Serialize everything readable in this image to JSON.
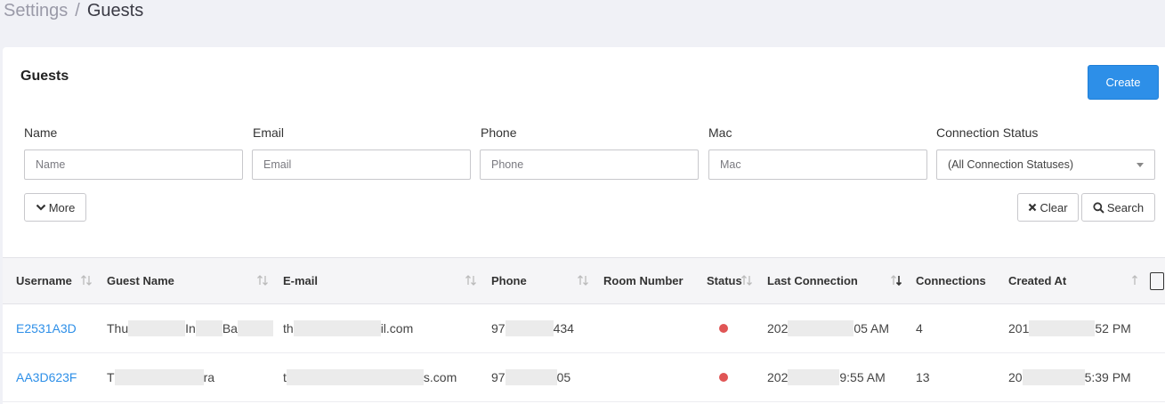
{
  "breadcrumb": {
    "parent": "Settings",
    "separator": "/",
    "current": "Guests"
  },
  "card": {
    "title": "Guests",
    "create_label": "Create"
  },
  "filters": {
    "name": {
      "label": "Name",
      "placeholder": "Name"
    },
    "email": {
      "label": "Email",
      "placeholder": "Email"
    },
    "phone": {
      "label": "Phone",
      "placeholder": "Phone"
    },
    "mac": {
      "label": "Mac",
      "placeholder": "Mac"
    },
    "status": {
      "label": "Connection Status",
      "selected": "(All Connection Statuses)"
    },
    "more_label": "More",
    "clear_label": "Clear",
    "search_label": "Search"
  },
  "table": {
    "columns": [
      "Username",
      "Guest Name",
      "E-mail",
      "Phone",
      "Room Number",
      "Status",
      "Last Connection",
      "Connections",
      "Created At"
    ],
    "rows": [
      {
        "username": "E2531A3D",
        "guest_name": {
          "a": "Thu",
          "b": "In",
          "c": "Ba"
        },
        "email": {
          "a": "th",
          "b": "il.com"
        },
        "phone": {
          "a": "97",
          "b": "434"
        },
        "room": "",
        "status": "offline",
        "last_connection": {
          "a": "202",
          "b": "05 AM"
        },
        "connections": "4",
        "created_at": {
          "a": "201",
          "b": "52 PM"
        }
      },
      {
        "username": "AA3D623F",
        "guest_name": {
          "a": "T",
          "b": "ra"
        },
        "email": {
          "a": "t",
          "b": "s.com"
        },
        "phone": {
          "a": "97",
          "b": "05"
        },
        "room": "",
        "status": "offline",
        "last_connection": {
          "a": "202",
          "b": "9:55 AM"
        },
        "connections": "13",
        "created_at": {
          "a": "20",
          "b": "5:39 PM"
        }
      }
    ]
  },
  "colors": {
    "accent": "#2d8fe8",
    "status_offline": "#e05555"
  }
}
